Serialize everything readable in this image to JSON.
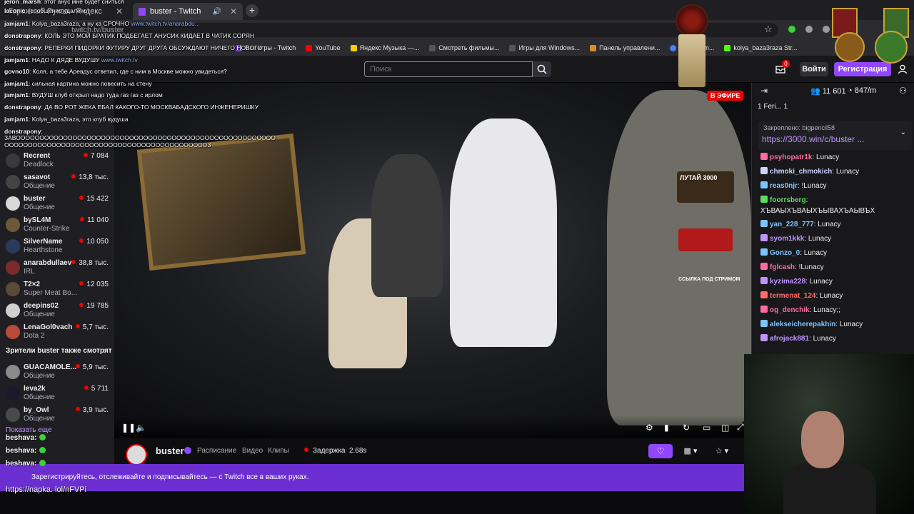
{
  "browser": {
    "tabs": [
      {
        "label": "Гаражный Рукав - Яндекс"
      },
      {
        "label": "buster - Twitch"
      }
    ],
    "url": "twitch.tv/buster",
    "bookmarks": [
      {
        "label": "Все игры - Twitch"
      },
      {
        "label": "YouTube"
      },
      {
        "label": "Яндекс Музыка —..."
      },
      {
        "label": "Смотреть фильмы..."
      },
      {
        "label": "Игры для Windows..."
      },
      {
        "label": "Панель управлени..."
      },
      {
        "label": "GoodGam..."
      },
      {
        "label": "kolya_baza3raza Str..."
      }
    ]
  },
  "topnav": {
    "search_placeholder": "Поиск",
    "notif_count": "0",
    "login_label": "Войти",
    "signup_label": "Регистрация"
  },
  "sidebar": {
    "channels": [
      {
        "name": "Recrent",
        "game": "Deadlock",
        "viewers": "7 084"
      },
      {
        "name": "sasavot",
        "game": "Общение",
        "viewers": "13,8 тыс."
      },
      {
        "name": "buster",
        "game": "Общение",
        "viewers": "15 422"
      },
      {
        "name": "bySL4M",
        "game": "Counter-Strike",
        "viewers": "11 040"
      },
      {
        "name": "SilverName",
        "game": "Hearthstone",
        "viewers": "10 050"
      },
      {
        "name": "anarabdullaev",
        "game": "IRL",
        "viewers": "38,8 тыс."
      },
      {
        "name": "T2×2",
        "game": "Super Meat Bo...",
        "viewers": "12 035"
      },
      {
        "name": "deepins02",
        "game": "Общение",
        "viewers": "19 785"
      },
      {
        "name": "LenaGol0vach",
        "game": "Dota 2",
        "viewers": "5,7 тыс."
      }
    ],
    "also_watch_title": "Зрители buster также смотрят",
    "also_watch": [
      {
        "name": "GUACAMOLE...",
        "game": "Общение",
        "viewers": "5,9 тыс."
      },
      {
        "name": "leva2k",
        "game": "Общение",
        "viewers": "5 711"
      },
      {
        "name": "by_Owl",
        "game": "Общение",
        "viewers": "3,9 тыс."
      }
    ],
    "show_more": "Показать еще"
  },
  "player": {
    "live_label": "В ЭФИРЕ",
    "ad_text": "ССЫЛКА ПОД СТРИМОМ",
    "ad_brand": "ЛУТАЙ 3000"
  },
  "info": {
    "streamer": "buster",
    "links": [
      "Расписание",
      "Видео",
      "Клипы"
    ],
    "delay_label": "Задержка",
    "delay_value": "2.68s"
  },
  "promo": {
    "text": "Зарегистрируйтесь, отслеживайте и подписывайтесь — с Twitch все в ваших руках."
  },
  "chat": {
    "viewers": "11 601",
    "uptime": "847/m",
    "gifts": "1  Feri...  1",
    "pinned_label": "Закреплено: bigpencil58",
    "pinned_link": "https://3000.win/c/buster ...",
    "messages": [
      {
        "user": "psyhopatr1k",
        "text": ": Lunacy",
        "color": "#ff6b9d"
      },
      {
        "user": "chmoki_chmokich",
        "text": ": Lunacy",
        "color": "#d0d0ff"
      },
      {
        "user": "reas0njr",
        "text": ": !Lunacy",
        "color": "#7cc4ff"
      },
      {
        "user": "foorrsberg",
        "text": ":",
        "color": "#5ddc5d"
      },
      {
        "user": "",
        "text": "ХЪВАЫХЪВАЫХЪЫВАХЪАЫВЪХ",
        "color": "#efeff1"
      },
      {
        "user": "yan_228_777",
        "text": ": Lunacy",
        "color": "#7cc4ff"
      },
      {
        "user": "syom1kkk",
        "text": ": Lunacy",
        "color": "#bf94ff"
      },
      {
        "user": "Gonzo_0",
        "text": ": Lunacy",
        "color": "#7cc4ff"
      },
      {
        "user": "fglcash",
        "text": ": !Lunacy",
        "color": "#ff6b9d"
      },
      {
        "user": "kyzima228",
        "text": ": Lunacy",
        "color": "#bf94ff"
      },
      {
        "user": "termenat_124",
        "text": ": Lunacy",
        "color": "#ff6b6b"
      },
      {
        "user": "og_denchik",
        "text": ": Lunacy;;",
        "color": "#ff6b9d"
      },
      {
        "user": "alekseicherepakhin",
        "text": ": Lunacy",
        "color": "#7cc4ff"
      },
      {
        "user": "afrojack881",
        "text": ": Lunacy",
        "color": "#bf94ff"
      }
    ]
  },
  "overlay_chat": [
    {
      "name": "jeron_marsh",
      "text": ": этот анус мне будет сниться"
    },
    {
      "name": "laconic",
      "text": ": [сообщение удалено]"
    },
    {
      "name": "jamjam1",
      "text": ": Kolya_baza3raza, а ну ка СРОЧНО ",
      "link": "www.twitch.tv/anarabdu..."
    },
    {
      "name": "donstrapony",
      "text": ": КОЛЬ ЭТО МОЙ БРАТИК ПОДБЕГАЕТ АНУСИК КИДАЕТ В ЧАТИК СОРЯН"
    },
    {
      "name": "donstrapony",
      "text": ": РЕПЕРКИ ПИДОРКИ ФУТИРУ ДРУГ ДРУГА ОБСУЖДАЮТ НИЧЕГО НОВОГО"
    },
    {
      "name": "jamjam1",
      "text": ": НАДО К ДЯДЕ ВУДУШУ ",
      "link": "www.twitch.tv"
    },
    {
      "name": "govno10",
      "text": ": Коля, а тебе Аревдус ответил, где с ним в Москве можно увидеться?"
    },
    {
      "name": "jamjam1",
      "text": ": сильная картина можно повесить на стену"
    },
    {
      "name": "jamjam1",
      "text": ": ВУДУШ клуб открыл надо туда газ газ с ирлом"
    },
    {
      "name": "donstrapony",
      "text": ": ДА ВО РОТ ЖЕКА ЕБАЛ КАКОГО-ТО МОСКВАБАДСКОГО ИНЖЕНЕРИШКУ"
    },
    {
      "name": "jamjam1",
      "text": ": Kolya_baza3raza, это клуб вудуша"
    },
    {
      "name": "donstrapony",
      "text": ":"
    },
    {
      "name": "",
      "text": "ЗАВООООООООООООООООООООООООООООООООООООООООООООООООООООООО"
    },
    {
      "name": "",
      "text": "ОООООООООООООООООООООООООООООООООООООООООООЗ"
    }
  ],
  "overlay_bottom": [
    {
      "name": "beshava:"
    },
    {
      "name": "beshava:"
    },
    {
      "name": "beshava:"
    }
  ],
  "overlay_link": "https://napka. lol/nFVPi"
}
